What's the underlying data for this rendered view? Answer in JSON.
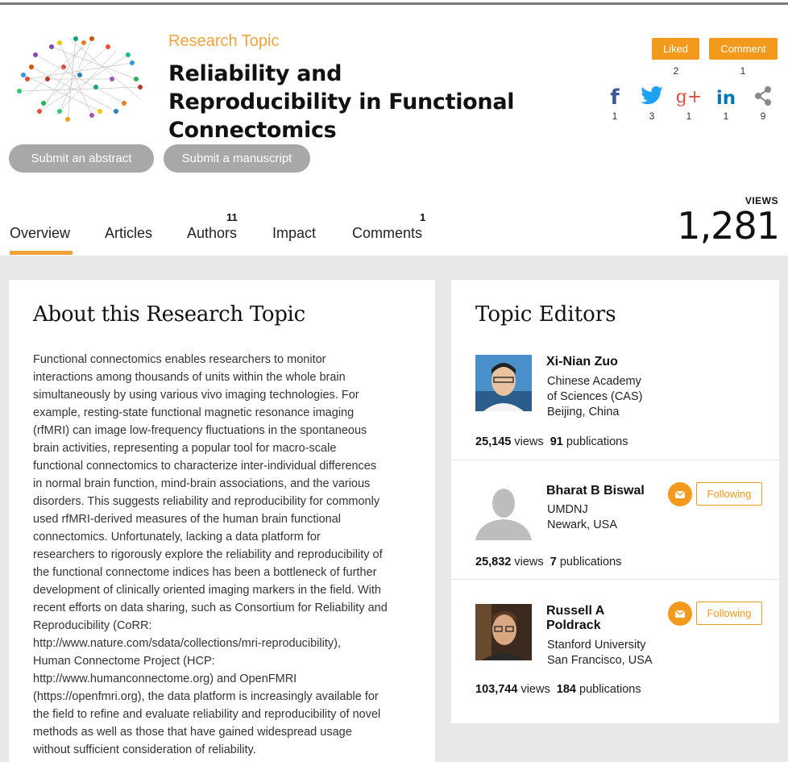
{
  "header": {
    "label": "Research Topic",
    "title": "Reliability and Reproducibility in Functional Connectomics",
    "actions": {
      "liked_label": "Liked",
      "liked_count": "2",
      "comment_label": "Comment",
      "comment_count": "1"
    },
    "social": [
      {
        "name": "facebook",
        "count": "1",
        "color": "#3b5998"
      },
      {
        "name": "twitter",
        "count": "3",
        "color": "#1da1f2"
      },
      {
        "name": "google-plus",
        "count": "1",
        "color": "#dd4b39"
      },
      {
        "name": "linkedin",
        "count": "1",
        "color": "#0077b5"
      },
      {
        "name": "share",
        "count": "9",
        "color": "#888888"
      }
    ],
    "submit_abstract": "Submit an abstract",
    "submit_manuscript": "Submit a manuscript"
  },
  "tabs": [
    {
      "label": "Overview",
      "count": "",
      "active": true
    },
    {
      "label": "Articles",
      "count": ""
    },
    {
      "label": "Authors",
      "count": "11"
    },
    {
      "label": "Impact",
      "count": ""
    },
    {
      "label": "Comments",
      "count": "1"
    }
  ],
  "views": {
    "label": "VIEWS",
    "value": "1,281"
  },
  "about": {
    "title": "About this Research Topic",
    "body": "Functional connectomics enables researchers to monitor\ninteractions among thousands of units within the whole brain\nsimultaneously by using various vivo imaging technologies. For\nexample, resting-state functional magnetic resonance imaging\n(rfMRI) can image low-frequency fluctuations in the spontaneous\nbrain activities, representing a popular tool for macro-scale\nfunctional connectomics to characterize inter-individual differences\nin normal brain function, mind-brain associations, and the various\ndisorders. This suggests reliability and reproducibility for commonly\nused rfMRI-derived measures of the human brain functional\nconnectomics. Unfortunately, lacking a data platform for\nresearchers to rigorously explore the reliability and reproducibility of\nthe functional connectome indices has been a bottleneck of further\ndevelopment of clinically oriented imaging markers in the field. With\nrecent efforts on data sharing, such as Consortium for Reliability and\nReproducibility (CoRR:\nhttp://www.nature.com/sdata/collections/mri-reproducibility),\nHuman Connectome Project (HCP:\nhttp://www.humanconnectome.org) and OpenFMRI\n(https://openfmri.org), the data platform is increasingly available for\nthe field to refine and evaluate reliability and reproducibility of novel\nmethods as well as those that have gained widespread usage\nwithout sufficient consideration of reliability."
  },
  "editors": {
    "title": "Topic Editors",
    "list": [
      {
        "name": "Xi-Nian Zuo",
        "affiliation": "Chinese Academy\nof Sciences (CAS)\nBeijing, China",
        "views": "25,145",
        "views_label": "views",
        "publications": "91",
        "publications_label": "publications"
      },
      {
        "name": "Bharat B Biswal",
        "affiliation": "UMDNJ\nNewark, USA",
        "views": "25,832",
        "views_label": "views",
        "publications": "7",
        "publications_label": "publications",
        "follow_label": "Following"
      },
      {
        "name": "Russell A\nPoldrack",
        "affiliation": "Stanford University\nSan Francisco, USA",
        "views": "103,744",
        "views_label": "views",
        "publications": "184",
        "publications_label": "publications",
        "follow_label": "Following"
      }
    ]
  },
  "colors": {
    "accent": "#f39a1c",
    "title_accent": "#f0a33a",
    "pill": "#a8a8a8",
    "background": "#e8e8e8"
  }
}
